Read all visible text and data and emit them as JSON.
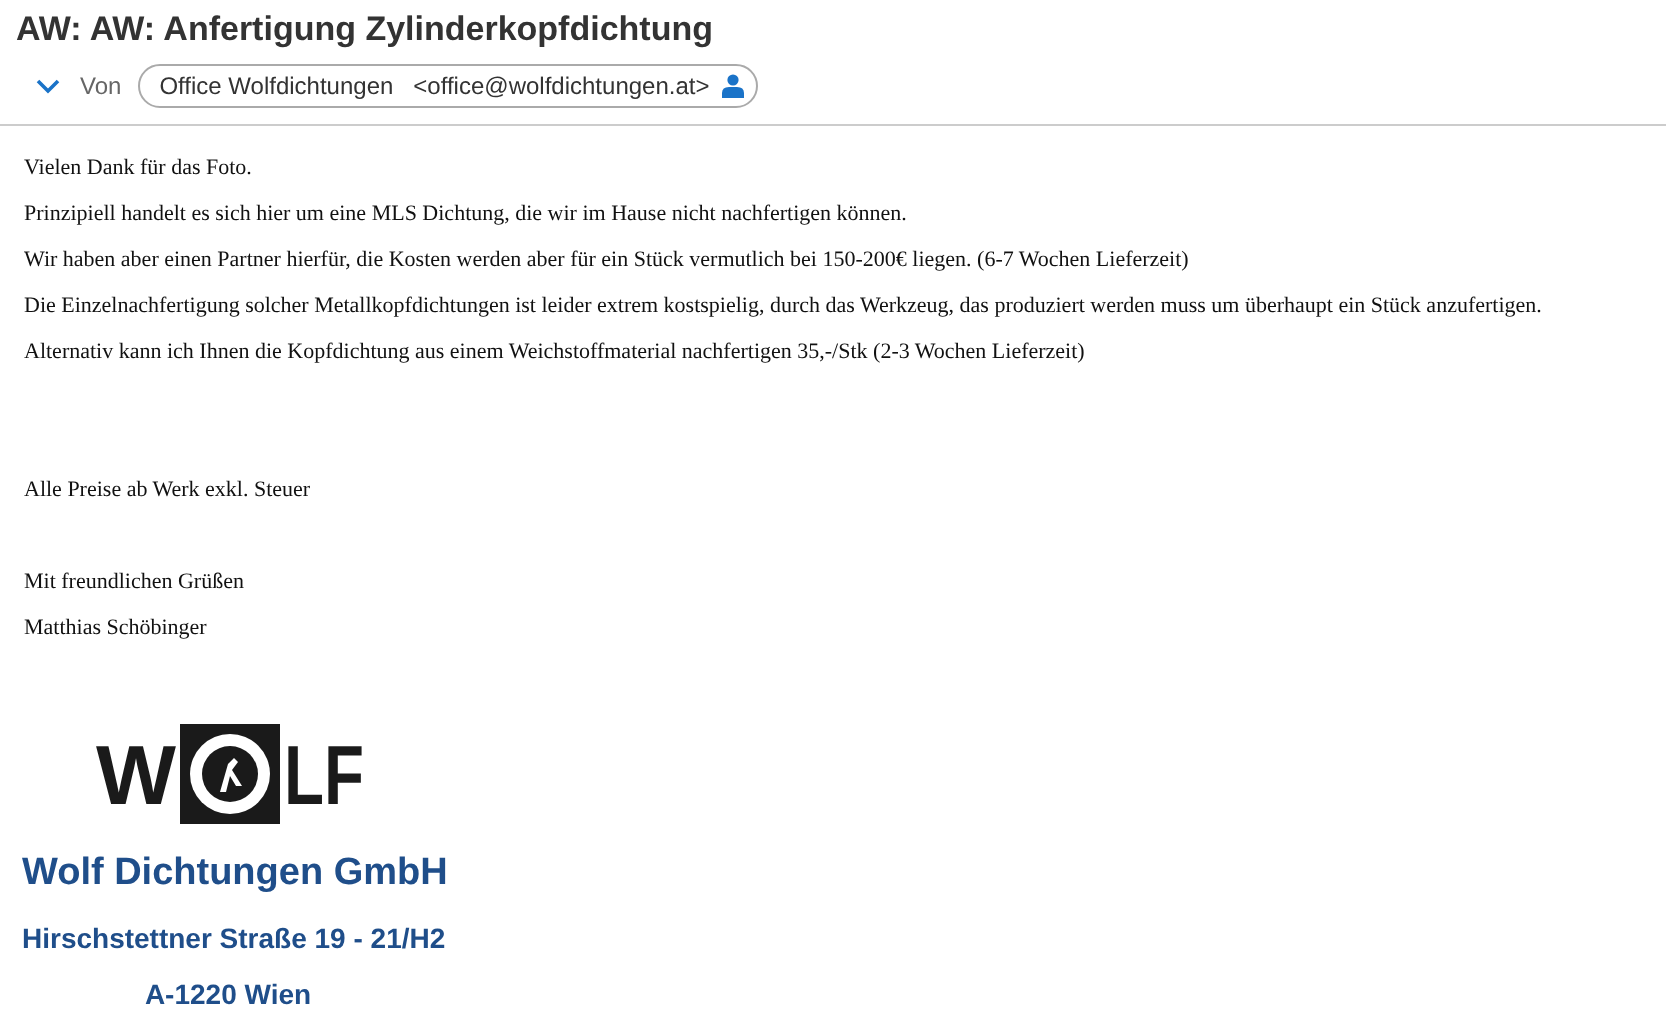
{
  "subject": "AW: AW: Anfertigung Zylinderkopfdichtung",
  "sender": {
    "label": "Von",
    "name": "Office Wolfdichtungen",
    "address": "<office@wolfdichtungen.at>",
    "expanded": false
  },
  "body": [
    [
      "Vielen Dank für das Foto.",
      "Prinzipiell handelt es sich hier um eine MLS Dichtung, die wir im Hause nicht nachfertigen können.",
      "Wir haben aber einen Partner hierfür, die Kosten werden aber für ein Stück vermutlich bei 150-200€ liegen. (6-7 Wochen Lieferzeit)",
      "Die Einzelnachfertigung solcher Metallkopfdichtungen ist leider extrem kostspielig, durch das Werkzeug, das produziert werden muss um überhaupt ein Stück anzufertigen.",
      "Alternativ kann ich Ihnen die Kopfdichtung aus einem Weichstoffmaterial nachfertigen 35,-/Stk (2-3 Wochen Lieferzeit)"
    ],
    [
      "Alle Preise ab Werk exkl. Steuer"
    ],
    [
      "Mit freundlichen Grüßen",
      "Matthias Schöbinger"
    ]
  ],
  "signature": {
    "logo": {
      "left": "W",
      "right": "LF"
    },
    "company": "Wolf Dichtungen GmbH",
    "street": "Hirschstettner Straße 19 - 21/H2",
    "city": "A-1220 Wien"
  }
}
